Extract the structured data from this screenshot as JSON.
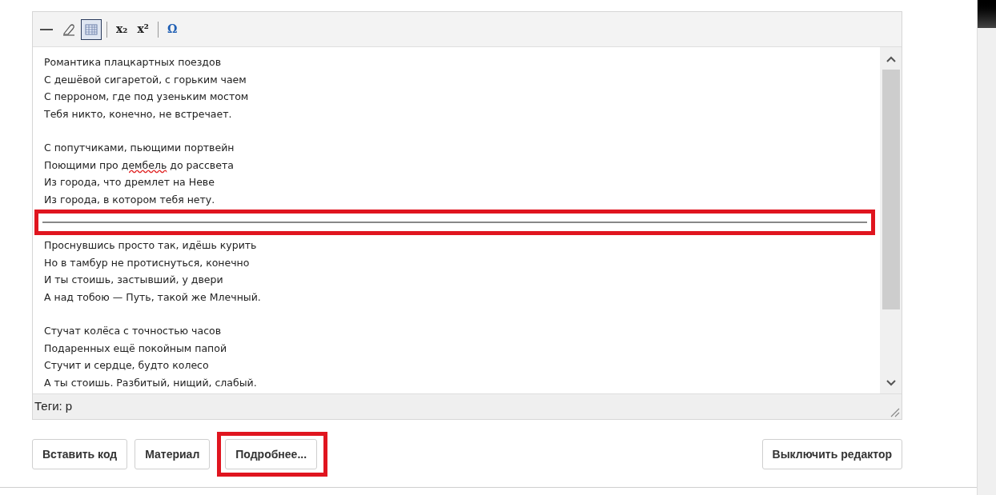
{
  "toolbar": [
    {
      "kind": "rule",
      "selected": false
    },
    {
      "kind": "eraser",
      "selected": false
    },
    {
      "kind": "table",
      "selected": true
    },
    {
      "kind": "separator"
    },
    {
      "kind": "subscript",
      "label": "x₂",
      "selected": false
    },
    {
      "kind": "superscript",
      "label": "x²",
      "selected": false
    },
    {
      "kind": "separator"
    },
    {
      "kind": "symbol",
      "label": "Ω",
      "selected": false
    }
  ],
  "content": [
    {
      "kind": "stanza",
      "lines": [
        [
          {
            "text": "Романтика плацкартных поездов",
            "misspelled": false
          }
        ],
        [
          {
            "text": "С дешёвой сигаретой, с горьким чаем",
            "misspelled": false
          }
        ],
        [
          {
            "text": "С перроном, где под узеньким мостом",
            "misspelled": false
          }
        ],
        [
          {
            "text": "Тебя никто, конечно, не встречает.",
            "misspelled": false
          }
        ]
      ]
    },
    {
      "kind": "stanza",
      "lines": [
        [
          {
            "text": "С попутчиками, пьющими портвейн",
            "misspelled": false
          }
        ],
        [
          {
            "text": "Поющими про ",
            "misspelled": false
          },
          {
            "text": "дембель",
            "misspelled": true
          },
          {
            "text": " до рассвета",
            "misspelled": false
          }
        ],
        [
          {
            "text": "Из города, что дремлет на Неве",
            "misspelled": false
          }
        ],
        [
          {
            "text": "Из города, в котором тебя нету.",
            "misspelled": false
          }
        ]
      ]
    },
    {
      "kind": "rule",
      "highlighted": true
    },
    {
      "kind": "stanza",
      "lines": [
        [
          {
            "text": "Проснувшись просто так, идёшь курить",
            "misspelled": false
          }
        ],
        [
          {
            "text": "Но в тамбур не протиснуться, конечно",
            "misspelled": false
          }
        ],
        [
          {
            "text": "И ты стоишь, застывший, у двери",
            "misspelled": false
          }
        ],
        [
          {
            "text": "А над тобою — Путь, такой же Млечный.",
            "misspelled": false
          }
        ]
      ]
    },
    {
      "kind": "stanza",
      "lines": [
        [
          {
            "text": "Стучат колёса с точностью часов",
            "misspelled": false
          }
        ],
        [
          {
            "text": "Подаренных ещё покойным папой",
            "misspelled": false
          }
        ],
        [
          {
            "text": "Стучит и сердце, будто колесо",
            "misspelled": false
          }
        ],
        [
          {
            "text": "А ты стоишь. Разбитый, нищий, слабый.",
            "misspelled": false
          }
        ]
      ]
    }
  ],
  "status_bar": {
    "text": "Теги: p"
  },
  "buttons_left": [
    {
      "label": "Вставить код",
      "highlighted": false
    },
    {
      "label": "Материал",
      "highlighted": false
    },
    {
      "label": "Подробнее...",
      "highlighted": true
    }
  ],
  "buttons_right": [
    {
      "label": "Выключить редактор",
      "highlighted": false
    }
  ]
}
